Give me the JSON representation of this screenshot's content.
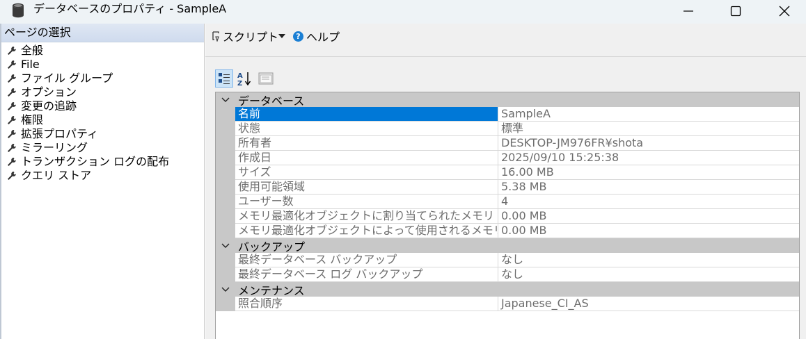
{
  "window": {
    "title": "データベースのプロパティ - SampleA",
    "icon": "database-icon"
  },
  "left": {
    "header": "ページの選択",
    "items": [
      {
        "label": "全般"
      },
      {
        "label": "File"
      },
      {
        "label": "ファイル グループ"
      },
      {
        "label": "オプション"
      },
      {
        "label": "変更の追跡"
      },
      {
        "label": "権限"
      },
      {
        "label": "拡張プロパティ"
      },
      {
        "label": "ミラーリング"
      },
      {
        "label": "トランザクション ログの配布"
      },
      {
        "label": "クエリ ストア"
      }
    ]
  },
  "toolbar": {
    "script_label": "スクリプト",
    "help_label": "ヘルプ"
  },
  "grid": {
    "categories": [
      {
        "label": "データベース",
        "rows": [
          {
            "name": "名前",
            "value": "SampleA"
          },
          {
            "name": "状態",
            "value": "標準"
          },
          {
            "name": "所有者",
            "value": "DESKTOP-JM976FR¥shota"
          },
          {
            "name": "作成日",
            "value": "2025/09/10 15:25:38"
          },
          {
            "name": "サイズ",
            "value": "16.00 MB"
          },
          {
            "name": "使用可能領域",
            "value": "5.38 MB"
          },
          {
            "name": "ユーザー数",
            "value": "4"
          },
          {
            "name": "メモリ最適化オブジェクトに割り当てられたメモリ",
            "value": "0.00 MB"
          },
          {
            "name": "メモリ最適化オブジェクトによって使用されるメモリ",
            "value": "0.00 MB"
          }
        ]
      },
      {
        "label": "バックアップ",
        "rows": [
          {
            "name": "最終データベース バックアップ",
            "value": "なし"
          },
          {
            "name": "最終データベース ログ バックアップ",
            "value": "なし"
          }
        ]
      },
      {
        "label": "メンテナンス",
        "rows": [
          {
            "name": "照合順序",
            "value": "Japanese_CI_AS"
          }
        ]
      }
    ]
  },
  "colors": {
    "selection": "#0078d7",
    "category_bg": "#c8c8c8",
    "header_bg": "#cfdbee"
  }
}
